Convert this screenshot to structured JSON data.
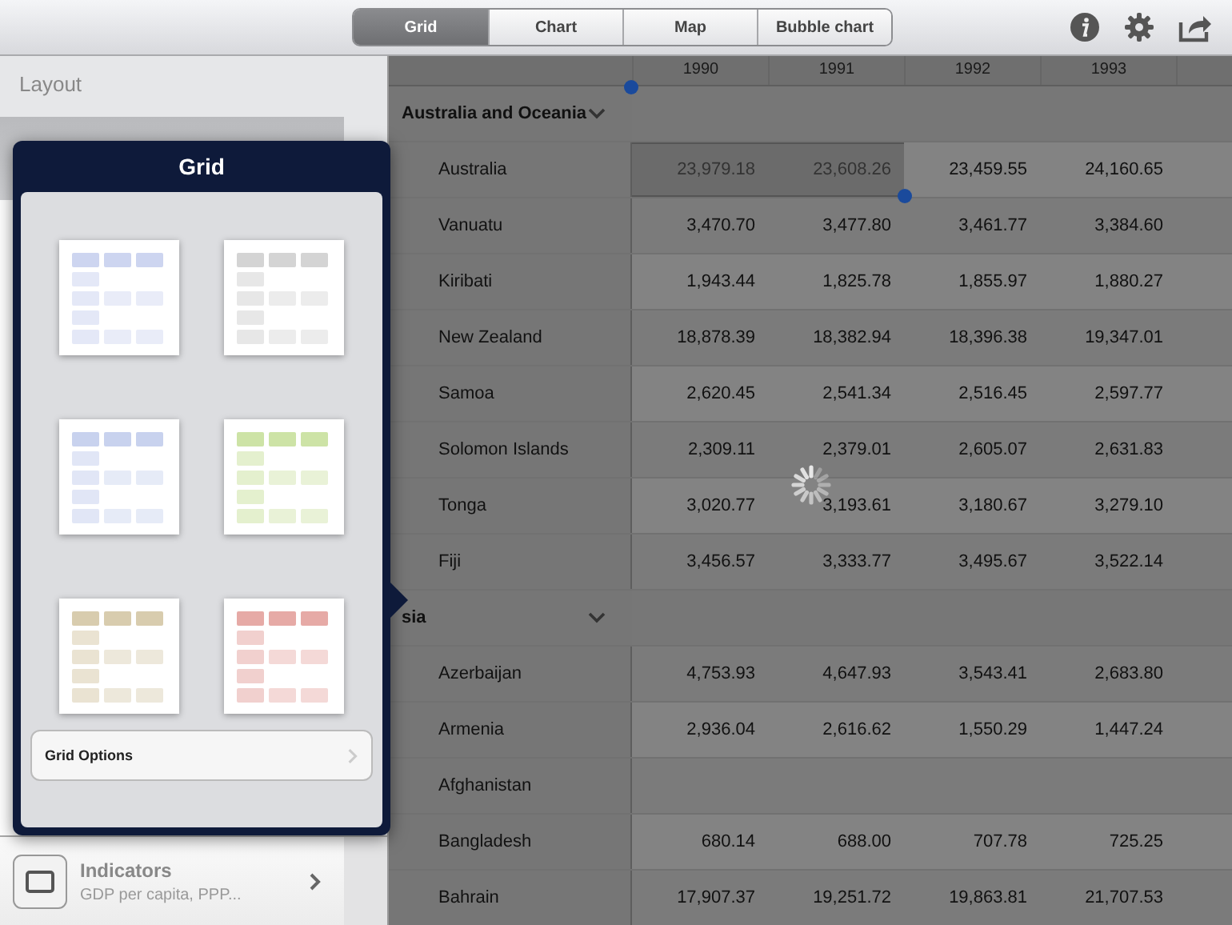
{
  "tabs": [
    {
      "label": "Grid",
      "selected": true
    },
    {
      "label": "Chart",
      "selected": false
    },
    {
      "label": "Map",
      "selected": false
    },
    {
      "label": "Bubble chart",
      "selected": false
    }
  ],
  "sidebar": {
    "title": "Layout",
    "indicators": {
      "label": "Indicators",
      "detail": "GDP per capita, PPP..."
    }
  },
  "popover": {
    "title": "Grid",
    "styles": [
      {
        "color": "#cdd5f0"
      },
      {
        "color": "#d4d4d4"
      },
      {
        "color": "#c8d2ee"
      },
      {
        "color": "#cde3a6"
      },
      {
        "color": "#d8ccae"
      },
      {
        "color": "#e6aaa6"
      }
    ],
    "options_label": "Grid Options"
  },
  "table": {
    "columns": [
      "1990",
      "1991",
      "1992",
      "1993"
    ],
    "rows": [
      {
        "kind": "group",
        "name": "Australia and Oceania",
        "expanded": true
      },
      {
        "kind": "row",
        "name": "Australia",
        "cells": [
          {
            "text": "23,979.18",
            "selected": true
          },
          {
            "text": "23,608.26",
            "selected": true
          },
          {
            "text": "23,459.55",
            "selected": false
          },
          {
            "text": "24,160.65",
            "selected": false
          }
        ]
      },
      {
        "kind": "row",
        "name": "Vanuatu",
        "cells": [
          {
            "text": "3,470.70",
            "selected": false
          },
          {
            "text": "3,477.80",
            "selected": false
          },
          {
            "text": "3,461.77",
            "selected": false
          },
          {
            "text": "3,384.60",
            "selected": false
          }
        ]
      },
      {
        "kind": "row",
        "name": "Kiribati",
        "cells": [
          {
            "text": "1,943.44",
            "selected": false
          },
          {
            "text": "1,825.78",
            "selected": false
          },
          {
            "text": "1,855.97",
            "selected": false
          },
          {
            "text": "1,880.27",
            "selected": false
          }
        ]
      },
      {
        "kind": "row",
        "name": "New Zealand",
        "cells": [
          {
            "text": "18,878.39",
            "selected": false
          },
          {
            "text": "18,382.94",
            "selected": false
          },
          {
            "text": "18,396.38",
            "selected": false
          },
          {
            "text": "19,347.01",
            "selected": false
          }
        ]
      },
      {
        "kind": "row",
        "name": "Samoa",
        "cells": [
          {
            "text": "2,620.45",
            "selected": false
          },
          {
            "text": "2,541.34",
            "selected": false
          },
          {
            "text": "2,516.45",
            "selected": false
          },
          {
            "text": "2,597.77",
            "selected": false
          }
        ]
      },
      {
        "kind": "row",
        "name": "Solomon Islands",
        "cells": [
          {
            "text": "2,309.11",
            "selected": false
          },
          {
            "text": "2,379.01",
            "selected": false
          },
          {
            "text": "2,605.07",
            "selected": false
          },
          {
            "text": "2,631.83",
            "selected": false
          }
        ]
      },
      {
        "kind": "row",
        "name": "Tonga",
        "cells": [
          {
            "text": "3,020.77",
            "selected": false
          },
          {
            "text": "3,193.61",
            "selected": false
          },
          {
            "text": "3,180.67",
            "selected": false
          },
          {
            "text": "3,279.10",
            "selected": false
          }
        ]
      },
      {
        "kind": "row",
        "name": "Fiji",
        "cells": [
          {
            "text": "3,456.57",
            "selected": false
          },
          {
            "text": "3,333.77",
            "selected": false
          },
          {
            "text": "3,495.67",
            "selected": false
          },
          {
            "text": "3,522.14",
            "selected": false
          }
        ]
      },
      {
        "kind": "group",
        "name": "sia",
        "expanded": true
      },
      {
        "kind": "row",
        "name": "Azerbaijan",
        "cells": [
          {
            "text": "4,753.93",
            "selected": false
          },
          {
            "text": "4,647.93",
            "selected": false
          },
          {
            "text": "3,543.41",
            "selected": false
          },
          {
            "text": "2,683.80",
            "selected": false
          }
        ]
      },
      {
        "kind": "row",
        "name": "Armenia",
        "cells": [
          {
            "text": "2,936.04",
            "selected": false
          },
          {
            "text": "2,616.62",
            "selected": false
          },
          {
            "text": "1,550.29",
            "selected": false
          },
          {
            "text": "1,447.24",
            "selected": false
          }
        ]
      },
      {
        "kind": "row",
        "name": "Afghanistan"
      },
      {
        "kind": "row",
        "name": "Bangladesh",
        "cells": [
          {
            "text": "680.14",
            "selected": false
          },
          {
            "text": "688.00",
            "selected": false
          },
          {
            "text": "707.78",
            "selected": false
          },
          {
            "text": "725.25",
            "selected": false
          }
        ]
      },
      {
        "kind": "row",
        "name": "Bahrain",
        "cells": [
          {
            "text": "17,907.37",
            "selected": false
          },
          {
            "text": "19,251.72",
            "selected": false
          },
          {
            "text": "19,863.81",
            "selected": false
          },
          {
            "text": "21,707.53",
            "selected": false
          }
        ]
      }
    ]
  }
}
